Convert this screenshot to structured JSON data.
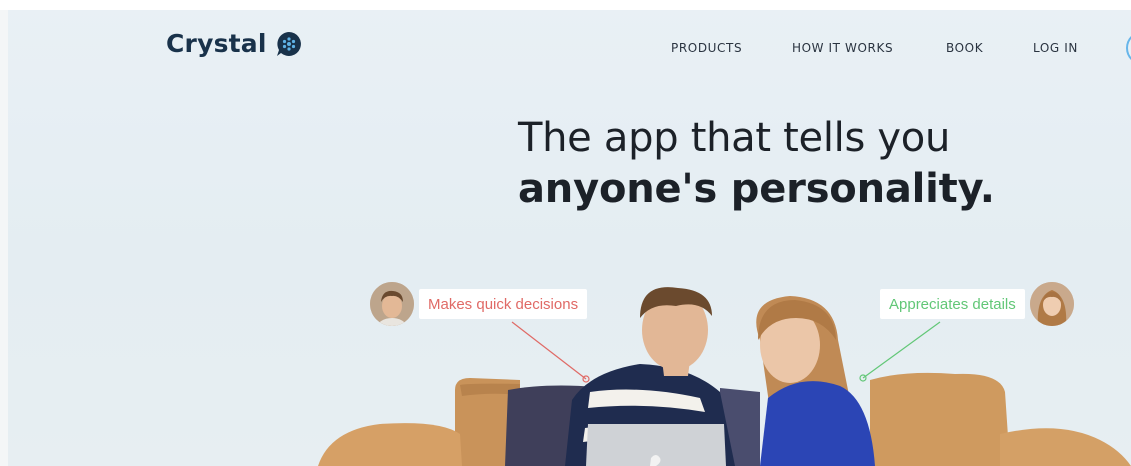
{
  "brand": {
    "name": "Crystal"
  },
  "nav": {
    "items": [
      "PRODUCTS",
      "HOW IT WORKS",
      "BOOK",
      "LOG IN"
    ]
  },
  "hero": {
    "line1": "The app that tells you",
    "line2": "anyone's personality."
  },
  "tags": {
    "left": "Makes quick decisions",
    "right": "Appreciates details"
  },
  "colors": {
    "brand_navy": "#19324a",
    "accent_blue": "#67b6ea",
    "tag_red": "#e06a66",
    "tag_green": "#62c777"
  }
}
